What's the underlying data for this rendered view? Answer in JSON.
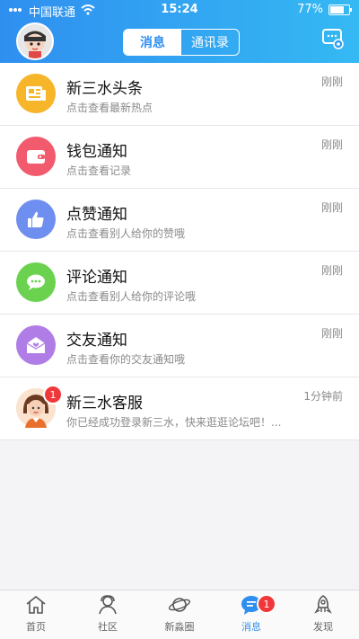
{
  "status_bar": {
    "carrier": "中国联通",
    "time": "15:24",
    "battery": "77%",
    "battery_level": 0.77
  },
  "header": {
    "tabs": [
      {
        "label": "消息",
        "active": true
      },
      {
        "label": "通讯录",
        "active": false
      }
    ]
  },
  "messages": [
    {
      "title": "新三水头条",
      "subtitle": "点击查看最新热点",
      "time": "刚刚",
      "icon": "newspaper-icon",
      "color": "#f7b62a"
    },
    {
      "title": "钱包通知",
      "subtitle": "点击查看记录",
      "time": "刚刚",
      "icon": "wallet-icon",
      "color": "#f15b6d"
    },
    {
      "title": "点赞通知",
      "subtitle": "点击查看别人给你的赞哦",
      "time": "刚刚",
      "icon": "thumbs-up-icon",
      "color": "#6f8ff0"
    },
    {
      "title": "评论通知",
      "subtitle": "点击查看别人给你的评论哦",
      "time": "刚刚",
      "icon": "chat-bubble-icon",
      "color": "#6ad24f"
    },
    {
      "title": "交友通知",
      "subtitle": "点击查看你的交友通知哦",
      "time": "刚刚",
      "icon": "envelope-heart-icon",
      "color": "#b07de6"
    },
    {
      "title": "新三水客服",
      "subtitle": "你已经成功登录新三水，快来逛逛论坛吧！...",
      "time": "1分钟前",
      "icon": "customer-service-avatar",
      "badge": "1"
    }
  ],
  "tabbar": [
    {
      "label": "首页",
      "icon": "home-icon",
      "active": false
    },
    {
      "label": "社区",
      "icon": "community-icon",
      "active": false
    },
    {
      "label": "新淼圈",
      "icon": "planet-icon",
      "active": false
    },
    {
      "label": "消息",
      "icon": "message-icon",
      "active": true,
      "badge": "1"
    },
    {
      "label": "发现",
      "icon": "rocket-icon",
      "active": false
    }
  ]
}
